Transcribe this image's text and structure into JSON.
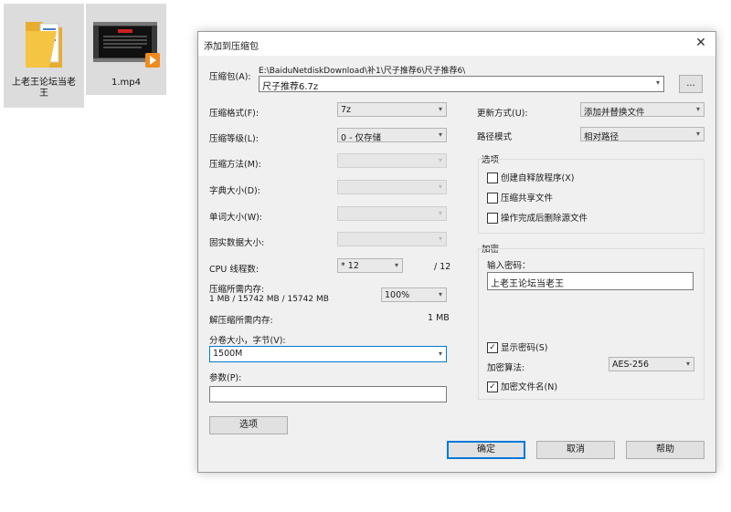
{
  "desktop": {
    "folder_label_line1": "上老王论坛当老",
    "folder_label_line2": "王",
    "video_label": "1.mp4"
  },
  "dialog": {
    "title": "添加到压缩包",
    "archive_label": "压缩包(A):",
    "archive_path": "E:\\BaiduNetdiskDownload\\补1\\尺子推荐6\\尺子推荐6\\",
    "archive_name": "尺子推荐6.7z",
    "browse_label": "...",
    "format_label": "压缩格式(F):",
    "format_value": "7z",
    "level_label": "压缩等级(L):",
    "level_value": "0 - 仅存储",
    "method_label": "压缩方法(M):",
    "dict_label": "字典大小(D):",
    "word_label": "单词大小(W):",
    "solid_label": "固实数据大小:",
    "cpu_label": "CPU 线程数:",
    "cpu_value": "* 12",
    "cpu_total": "/ 12",
    "mem_label": "压缩所需内存:",
    "mem_detail": "1 MB / 15742 MB / 15742 MB",
    "mem_percent": "100%",
    "demem_label": "解压缩所需内存:",
    "demem_value": "1 MB",
    "split_label": "分卷大小，字节(V):",
    "split_value": "1500M",
    "params_label": "参数(P):",
    "options_button": "选项",
    "update_label": "更新方式(U):",
    "update_value": "添加并替换文件",
    "path_label": "路径模式",
    "path_value": "相对路径",
    "options_group": "选项",
    "opt_sfx": "创建自释放程序(X)",
    "opt_shared": "压缩共享文件",
    "opt_delete": "操作完成后删除源文件",
    "encrypt_group": "加密",
    "password_label": "输入密码：",
    "password_value": "上老王论坛当老王",
    "show_password": "显示密码(S)",
    "enc_method_label": "加密算法:",
    "enc_method_value": "AES-256",
    "enc_names": "加密文件名(N)",
    "ok_button": "确定",
    "cancel_button": "取消",
    "help_button": "帮助"
  },
  "colors": {
    "accent": "#0078d7",
    "folder": "#f5c443"
  }
}
